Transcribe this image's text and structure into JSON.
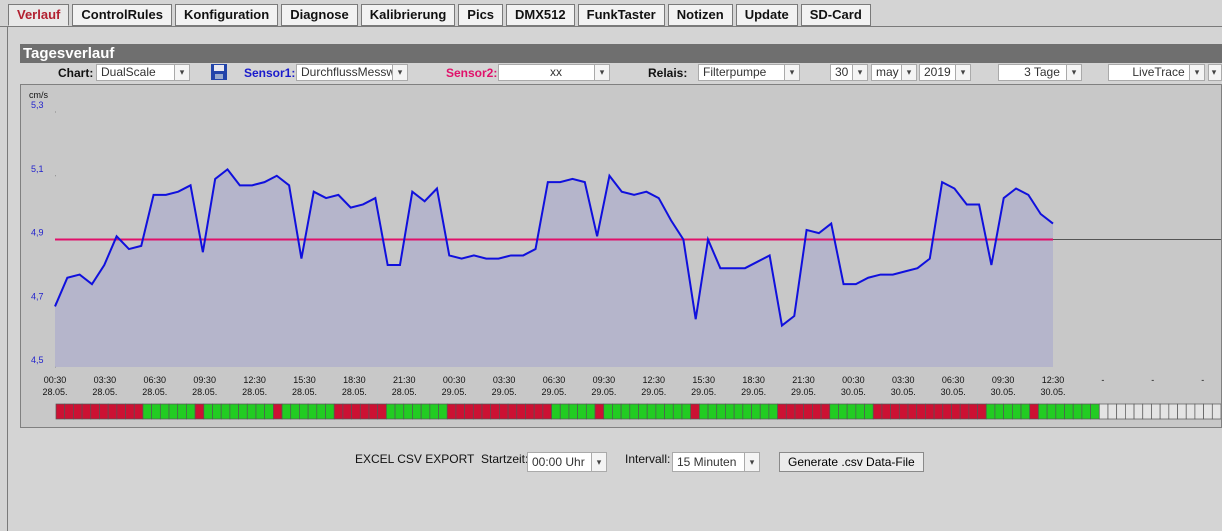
{
  "tabs": [
    {
      "label": "Verlauf",
      "active": true
    },
    {
      "label": "ControlRules"
    },
    {
      "label": "Konfiguration"
    },
    {
      "label": "Diagnose"
    },
    {
      "label": "Kalibrierung"
    },
    {
      "label": "Pics"
    },
    {
      "label": "DMX512"
    },
    {
      "label": "FunkTaster"
    },
    {
      "label": "Notizen"
    },
    {
      "label": "Update"
    },
    {
      "label": "SD-Card"
    }
  ],
  "panel": {
    "title": "Tagesverlauf"
  },
  "controls": {
    "chart_label": "Chart:",
    "chart_value": "DualScale",
    "sensor1_label": "Sensor1:",
    "sensor1_value": "DurchflussMessw",
    "sensor2_label": "Sensor2:",
    "sensor2_value": "xx",
    "relais_label": "Relais:",
    "relais_value": "Filterpumpe",
    "day": "30",
    "month": "may",
    "year": "2019",
    "range": "3 Tage",
    "mode": "LiveTrace"
  },
  "colors": {
    "sensor1": "#1010dd",
    "sensor2": "#e0106a",
    "relay_on": "#22cc22",
    "relay_off": "#cc1133",
    "fill": "#b0b0cc"
  },
  "icons": {
    "save": "floppy-disk-icon",
    "dropdown": "chevron-down-icon"
  },
  "export": {
    "title": "EXCEL CSV EXPORT",
    "start_label": "Startzeit:",
    "start_value": "00:00 Uhr",
    "interval_label": "Intervall:",
    "interval_value": "15 Minuten",
    "button": "Generate .csv Data-File"
  },
  "chart_data": {
    "type": "line",
    "ylabel": "cm/s",
    "ylim": [
      4.5,
      5.3
    ],
    "yticks": [
      "5,3",
      "5,1",
      "4,9",
      "4,7",
      "4,5"
    ],
    "threshold": 4.9,
    "x_times": [
      "00:30",
      "03:30",
      "06:30",
      "09:30",
      "12:30",
      "15:30",
      "18:30",
      "21:30",
      "00:30",
      "03:30",
      "06:30",
      "09:30",
      "12:30",
      "15:30",
      "18:30",
      "21:30",
      "00:30",
      "03:30",
      "06:30",
      "09:30",
      "12:30",
      "-",
      "-",
      "-"
    ],
    "x_dates": [
      "28.05.",
      "28.05.",
      "28.05.",
      "28.05.",
      "28.05.",
      "28.05.",
      "28.05.",
      "28.05.",
      "29.05.",
      "29.05.",
      "29.05.",
      "29.05.",
      "29.05.",
      "29.05.",
      "29.05.",
      "29.05.",
      "30.05.",
      "30.05.",
      "30.05.",
      "30.05.",
      "30.05.",
      "",
      "",
      ""
    ],
    "series": [
      {
        "values": [
          4.69,
          4.78,
          4.79,
          4.76,
          4.82,
          4.91,
          4.87,
          4.88,
          5.04,
          5.04,
          5.05,
          5.07,
          4.86,
          5.09,
          5.12,
          5.07,
          5.07,
          5.08,
          5.1,
          5.07,
          4.84,
          5.05,
          5.03,
          5.04,
          5.0,
          5.01,
          5.03,
          4.82,
          4.82,
          5.05,
          5.02,
          5.06,
          4.85,
          4.84,
          4.85,
          4.84,
          4.84,
          4.85,
          4.85,
          4.87,
          5.08,
          5.08,
          5.09,
          5.08,
          4.91,
          5.1,
          5.05,
          5.04,
          5.05,
          5.03,
          4.96,
          4.9,
          4.65,
          4.9,
          4.81,
          4.81,
          4.81,
          4.83,
          4.85,
          4.63,
          4.66,
          4.93,
          4.92,
          4.95,
          4.76,
          4.76,
          4.78,
          4.79,
          4.79,
          4.8,
          4.81,
          4.84,
          5.08,
          5.06,
          5.01,
          5.01,
          4.82,
          5.03,
          5.06,
          5.04,
          4.98,
          4.95
        ]
      }
    ],
    "relay": "rrrrrrrrrrggggggrggggggggrggggggrrrrrrgggggggrrrrrrrrrrrrgggggrggggggggggrgggggggggrrrrrrgggggrrrrrrrrrrrrrgggggrgggggggxxxxxxxxxxxxxx"
  }
}
